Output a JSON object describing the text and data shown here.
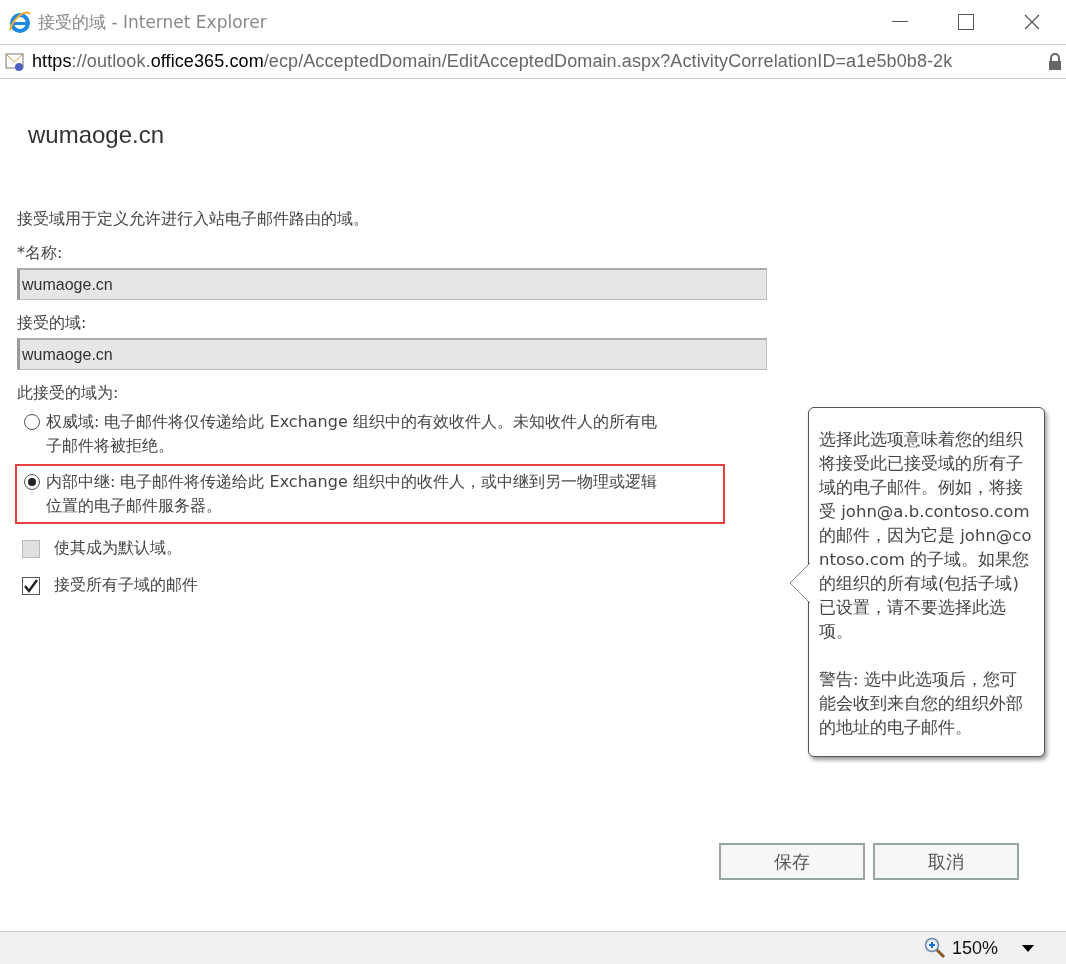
{
  "window": {
    "title": "接受的域 - Internet Explorer"
  },
  "address_bar": {
    "segments": [
      {
        "text": "https",
        "strong": true
      },
      {
        "text": "://outlook.",
        "strong": false
      },
      {
        "text": "office365.com",
        "strong": true
      },
      {
        "text": "/ecp/AcceptedDomain/EditAcceptedDomain.aspx?ActivityCorrelationID=a1e5b0b8-2k",
        "strong": false
      }
    ]
  },
  "page": {
    "heading": "wumaoge.cn",
    "description": "接受域用于定义允许进行入站电子邮件路由的域。",
    "fields": [
      {
        "label": "*名称:",
        "value": "wumaoge.cn",
        "disabled": true
      },
      {
        "label": "接受的域:",
        "value": "wumaoge.cn",
        "disabled": true
      }
    ],
    "domain_type": {
      "label": "此接受的域为:",
      "options": [
        {
          "text": "权威域: 电子邮件将仅传递给此 Exchange 组织中的有效收件人。未知收件人的所有电子邮件将被拒绝。",
          "selected": false,
          "highlighted": false
        },
        {
          "text": "内部中继: 电子邮件将传递给此 Exchange 组织中的收件人，或中继到另一物理或逻辑位置的电子邮件服务器。",
          "selected": true,
          "highlighted": true
        }
      ]
    },
    "checkboxes": [
      {
        "label": "使其成为默认域。",
        "checked": false,
        "disabled": true
      },
      {
        "label": "接受所有子域的邮件",
        "checked": true,
        "disabled": false
      }
    ],
    "tooltip": {
      "paragraphs": [
        "选择此选项意味着您的组织将接受此已接受域的所有子域的电子邮件。例如，将接受 john@a.b.contoso.com 的邮件，因为它是 john@contoso.com 的子域。如果您的组织的所有域(包括子域)已设置，请不要选择此选项。",
        "警告: 选中此选项后，您可能会收到来自您的组织外部的地址的电子邮件。"
      ]
    },
    "buttons": [
      "保存",
      "取消"
    ]
  },
  "status_bar": {
    "zoom": "150%"
  }
}
